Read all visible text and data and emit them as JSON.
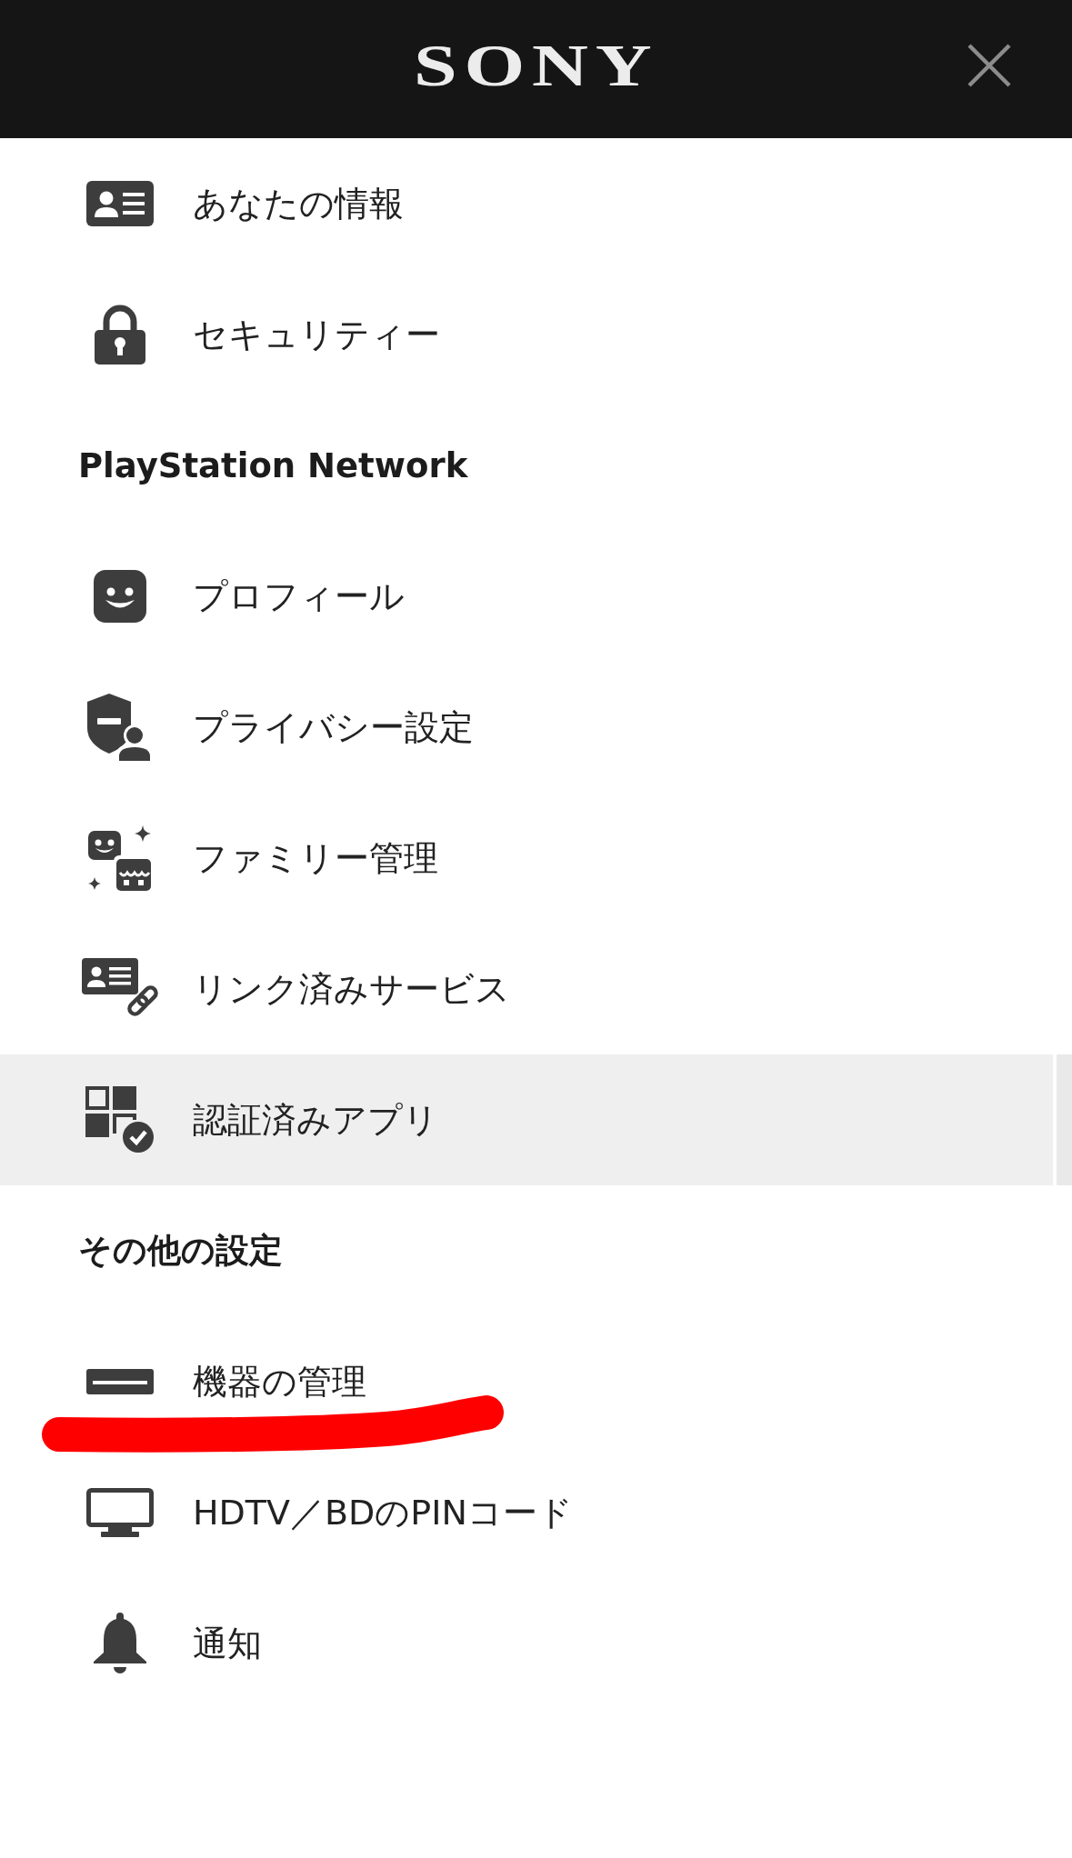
{
  "header": {
    "logo": "SONY"
  },
  "sections": [
    {
      "items": [
        {
          "kind": "info",
          "label": "あなたの情報",
          "selected": false,
          "marked": false
        },
        {
          "kind": "security",
          "label": "セキュリティー",
          "selected": false,
          "marked": false
        }
      ]
    },
    {
      "heading": "PlayStation Network",
      "items": [
        {
          "kind": "profile",
          "label": "プロフィール",
          "selected": false,
          "marked": false
        },
        {
          "kind": "privacy",
          "label": "プライバシー設定",
          "selected": false,
          "marked": false
        },
        {
          "kind": "family",
          "label": "ファミリー管理",
          "selected": false,
          "marked": false
        },
        {
          "kind": "linked",
          "label": "リンク済みサービス",
          "selected": false,
          "marked": false
        },
        {
          "kind": "apps",
          "label": "認証済みアプリ",
          "selected": true,
          "marked": false
        }
      ]
    },
    {
      "heading": "その他の設定",
      "items": [
        {
          "kind": "devices",
          "label": "機器の管理",
          "selected": false,
          "marked": true
        },
        {
          "kind": "tv",
          "label": "HDTV／BDのPINコード",
          "selected": false,
          "marked": false
        },
        {
          "kind": "notifications",
          "label": "通知",
          "selected": false,
          "marked": false
        }
      ]
    }
  ]
}
